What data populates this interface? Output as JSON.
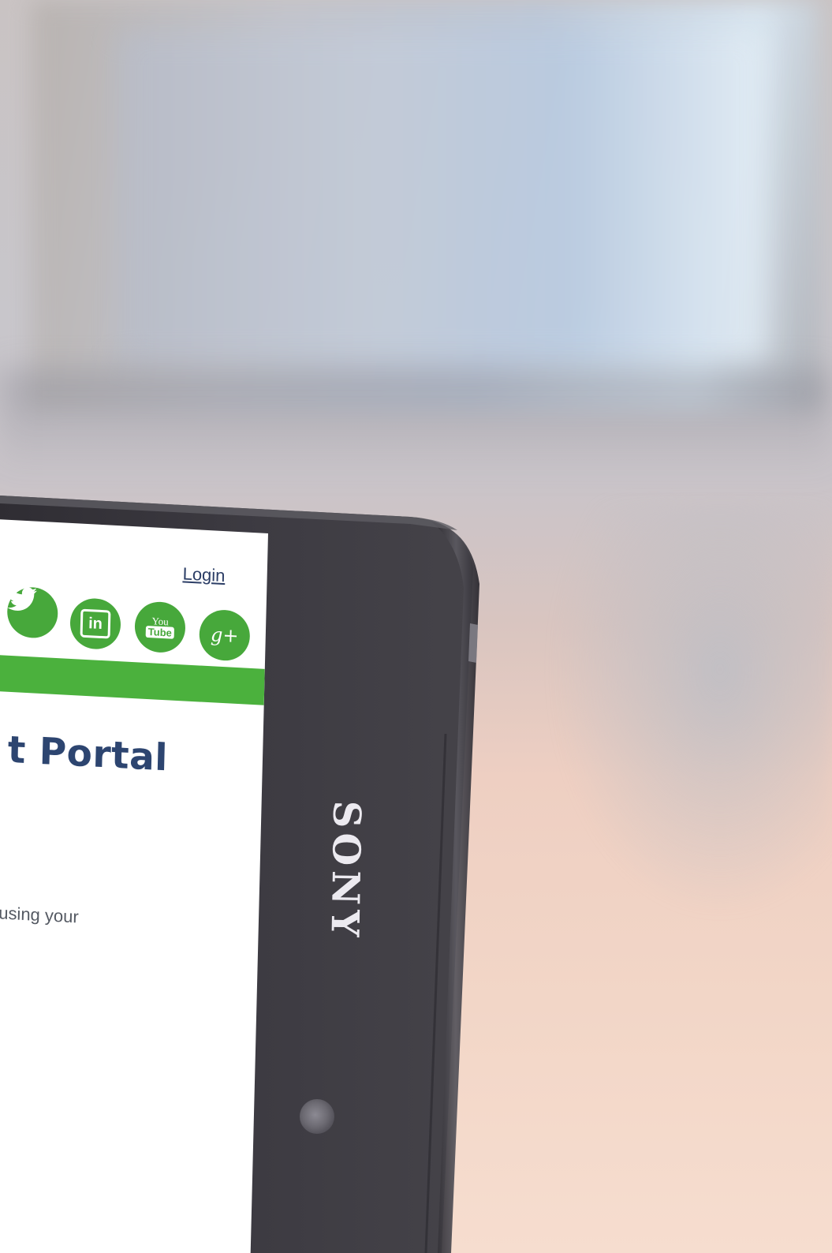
{
  "screen": {
    "login_label": "Login",
    "title_fragment": "t Portal",
    "intro_fragment": "n using your",
    "social_icons": [
      "twitter-icon",
      "linkedin-icon",
      "youtube-icon",
      "google-plus-icon"
    ],
    "youtube_text_top": "You",
    "youtube_text_bottom": "Tube",
    "linkedin_text": "in",
    "google_plus_text": "g+"
  },
  "device": {
    "brand": "SONY"
  },
  "colors": {
    "accent_green": "#4bb13d",
    "title_navy": "#2d4570",
    "link_navy": "#2c3e66",
    "bezel": "#3a383f"
  }
}
